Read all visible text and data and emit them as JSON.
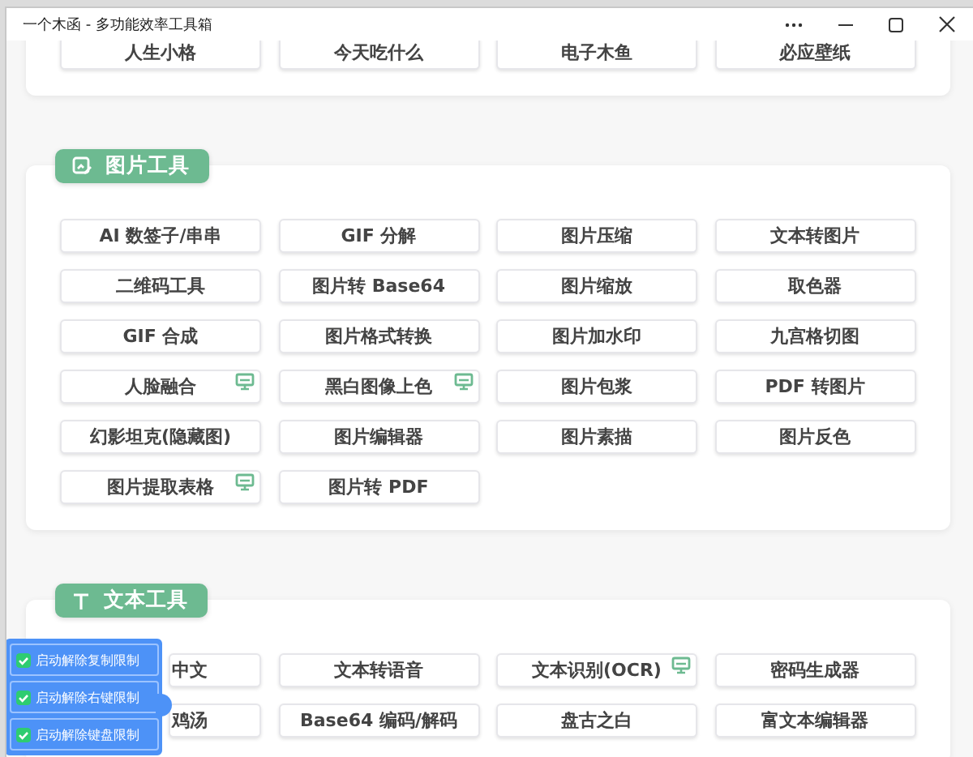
{
  "window": {
    "title": "一个木函 - 多功能效率工具箱"
  },
  "sections": [
    {
      "tools": [
        {
          "label": "人生小格",
          "pc_only": false
        },
        {
          "label": "今天吃什么",
          "pc_only": false
        },
        {
          "label": "电子木鱼",
          "pc_only": false
        },
        {
          "label": "必应壁纸",
          "pc_only": false
        }
      ]
    },
    {
      "title": "图片工具",
      "kind": "image",
      "tools": [
        {
          "label": "AI 数签子/串串",
          "pc_only": false
        },
        {
          "label": "GIF 分解",
          "pc_only": false
        },
        {
          "label": "图片压缩",
          "pc_only": false
        },
        {
          "label": "文本转图片",
          "pc_only": false
        },
        {
          "label": "二维码工具",
          "pc_only": false
        },
        {
          "label": "图片转 Base64",
          "pc_only": false
        },
        {
          "label": "图片缩放",
          "pc_only": false
        },
        {
          "label": "取色器",
          "pc_only": false
        },
        {
          "label": "GIF 合成",
          "pc_only": false
        },
        {
          "label": "图片格式转换",
          "pc_only": false
        },
        {
          "label": "图片加水印",
          "pc_only": false
        },
        {
          "label": "九宫格切图",
          "pc_only": false
        },
        {
          "label": "人脸融合",
          "pc_only": true
        },
        {
          "label": "黑白图像上色",
          "pc_only": true
        },
        {
          "label": "图片包浆",
          "pc_only": false
        },
        {
          "label": "PDF 转图片",
          "pc_only": false
        },
        {
          "label": "幻影坦克(隐藏图)",
          "pc_only": false
        },
        {
          "label": "图片编辑器",
          "pc_only": false
        },
        {
          "label": "图片素描",
          "pc_only": false
        },
        {
          "label": "图片反色",
          "pc_only": false
        },
        {
          "label": "图片提取表格",
          "pc_only": true
        },
        {
          "label": "图片转 PDF",
          "pc_only": false
        }
      ]
    },
    {
      "title": "文本工具",
      "kind": "text",
      "tools": [
        {
          "label": "中文",
          "pc_only": false,
          "covered": true
        },
        {
          "label": "文本转语音",
          "pc_only": false
        },
        {
          "label": "文本识别(OCR)",
          "pc_only": true
        },
        {
          "label": "密码生成器",
          "pc_only": false
        },
        {
          "label": "鸡汤",
          "pc_only": false,
          "covered": true
        },
        {
          "label": "Base64 编码/解码",
          "pc_only": false
        },
        {
          "label": "盘古之白",
          "pc_only": false
        },
        {
          "label": "富文本编辑器",
          "pc_only": false
        }
      ]
    }
  ],
  "unlock_panel": {
    "items": [
      {
        "label": "启动解除复制限制",
        "checked": true
      },
      {
        "label": "启动解除右键限制",
        "checked": true
      },
      {
        "label": "启动解除键盘限制",
        "checked": true
      }
    ]
  }
}
